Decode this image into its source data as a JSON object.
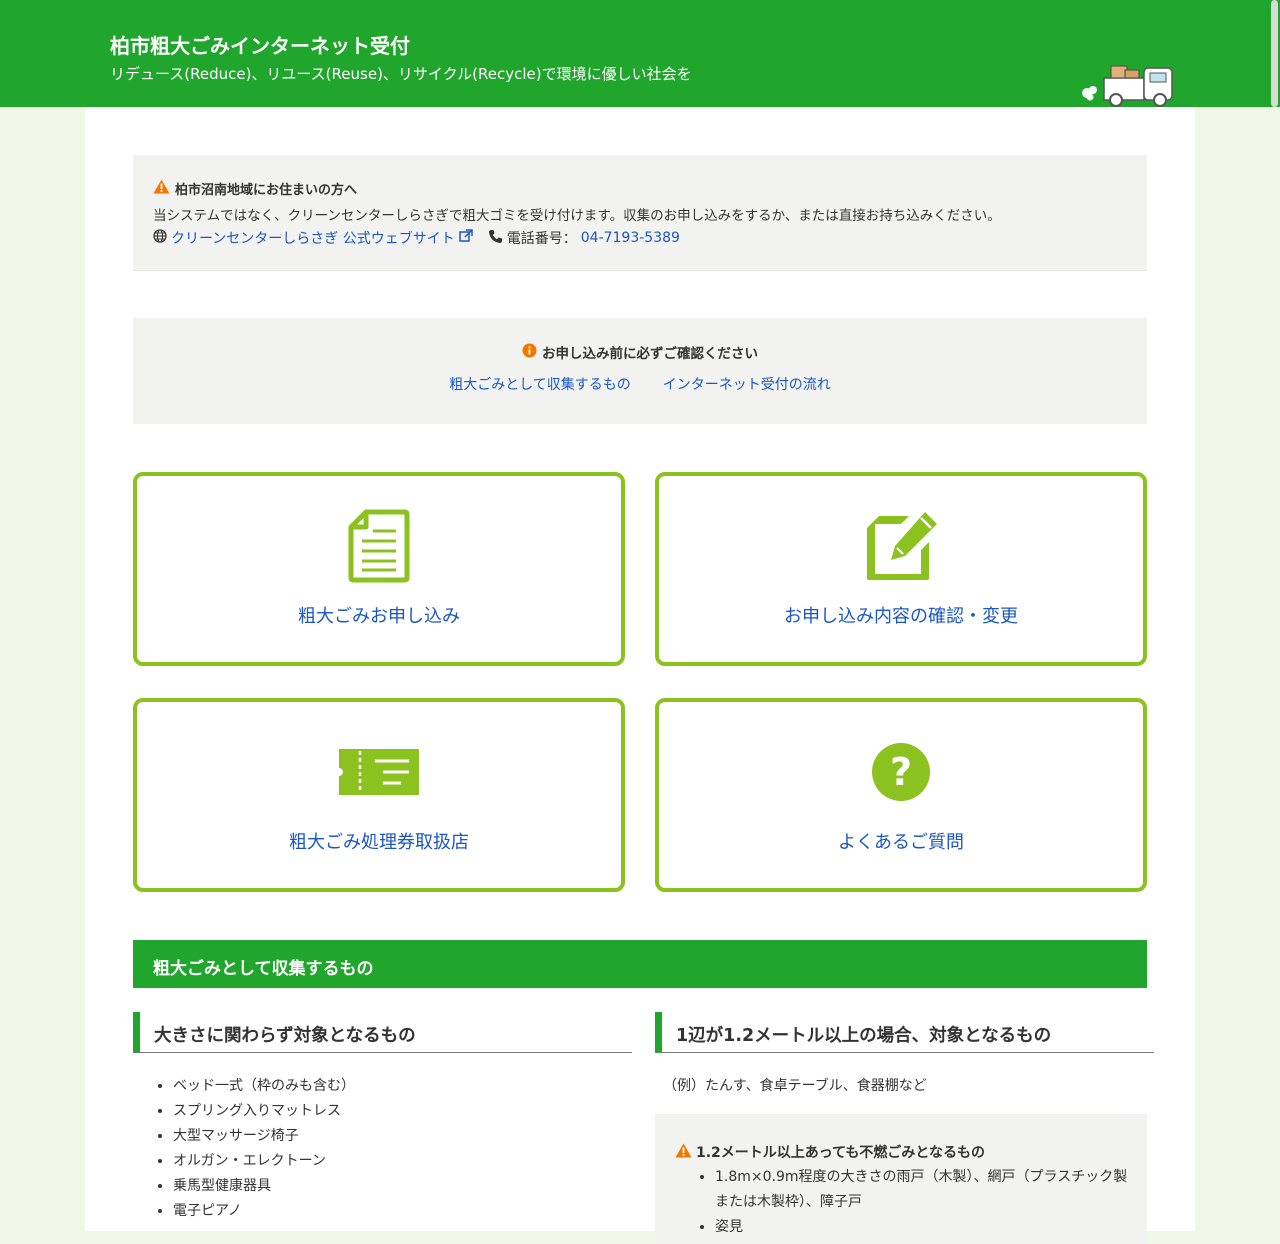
{
  "header": {
    "title": "柏市粗大ごみインターネット受付",
    "subtitle": "リデュース(Reduce)、リユース(Reuse)、リサイクル(Recycle)で環境に優しい社会を"
  },
  "notice_area": {
    "title": "柏市沼南地域にお住まいの方へ",
    "body": "当システムではなく、クリーンセンターしらさぎで粗大ゴミを受け付けます。収集のお申し込みをするか、または直接お持ち込みください。",
    "website_link": "クリーンセンターしらさぎ 公式ウェブサイト",
    "phone_label": "電話番号：",
    "phone_number": "04-7193-5389"
  },
  "notice_confirm": {
    "title": "お申し込み前に必ずご確認ください",
    "links": [
      "粗大ごみとして収集するもの",
      "インターネット受付の流れ"
    ]
  },
  "cards": [
    {
      "label": "粗大ごみお申し込み",
      "icon": "document-icon"
    },
    {
      "label": "お申し込み内容の確認・変更",
      "icon": "edit-icon"
    },
    {
      "label": "粗大ごみ処理券取扱店",
      "icon": "ticket-icon"
    },
    {
      "label": "よくあるご質問",
      "icon": "question-icon"
    }
  ],
  "section": {
    "title": "粗大ごみとして収集するもの",
    "left_heading": "大きさに関わらず対象となるもの",
    "left_items": [
      "ベッド一式（枠のみも含む）",
      "スプリング入りマットレス",
      "大型マッサージ椅子",
      "オルガン・エレクトーン",
      "乗馬型健康器具",
      "電子ピアノ"
    ],
    "right_heading": "1辺が1.2メートル以上の場合、対象となるもの",
    "right_example": "（例）たんす、食卓テーブル、食器棚など",
    "warning_title": "1.2メートル以上あっても不燃ごみとなるもの",
    "warning_items": [
      "1.8m×0.9m程度の大きさの雨戸（木製）、網戸（プラスチック製または木製枠）、障子戸",
      "姿見"
    ]
  },
  "colors": {
    "header_green": "#21a62d",
    "card_border": "#8cc21f",
    "link_blue": "#1a56c4",
    "warning_orange": "#f07800"
  }
}
